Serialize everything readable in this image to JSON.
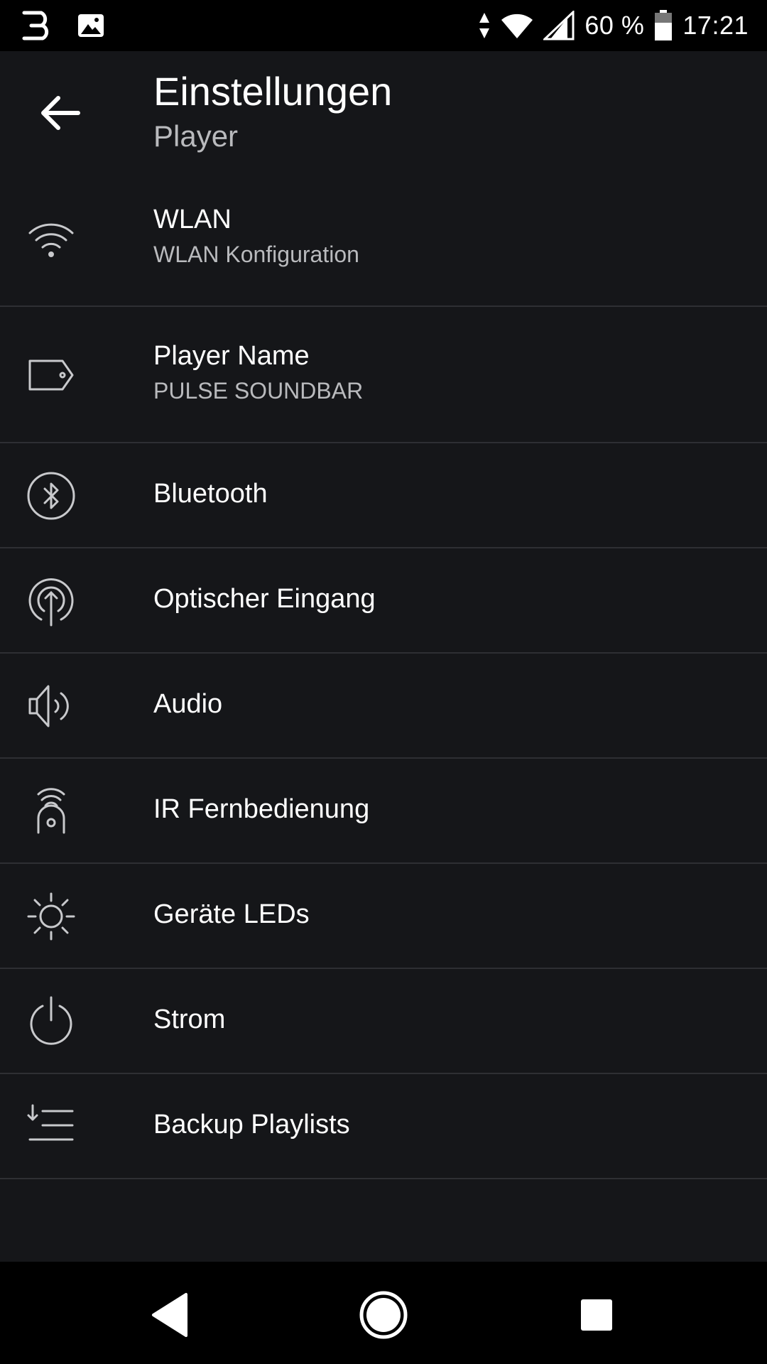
{
  "status_bar": {
    "battery": "60 %",
    "time": "17:21"
  },
  "header": {
    "title": "Einstellungen",
    "subtitle": "Player"
  },
  "items": [
    {
      "label": "WLAN",
      "sublabel": "WLAN Konfiguration",
      "icon": "wifi-icon"
    },
    {
      "label": "Player Name",
      "sublabel": "PULSE SOUNDBAR",
      "icon": "tag-icon"
    },
    {
      "label": "Bluetooth",
      "icon": "bluetooth-icon"
    },
    {
      "label": "Optischer Eingang",
      "icon": "optical-input-icon"
    },
    {
      "label": "Audio",
      "icon": "speaker-icon"
    },
    {
      "label": "IR Fernbedienung",
      "icon": "remote-icon"
    },
    {
      "label": "Geräte LEDs",
      "icon": "brightness-icon"
    },
    {
      "label": "Strom",
      "icon": "power-icon"
    },
    {
      "label": "Backup Playlists",
      "icon": "playlist-icon"
    }
  ],
  "colors": {
    "background": "#151619",
    "divider": "#2e2f33",
    "secondary_text": "#b9babd"
  }
}
